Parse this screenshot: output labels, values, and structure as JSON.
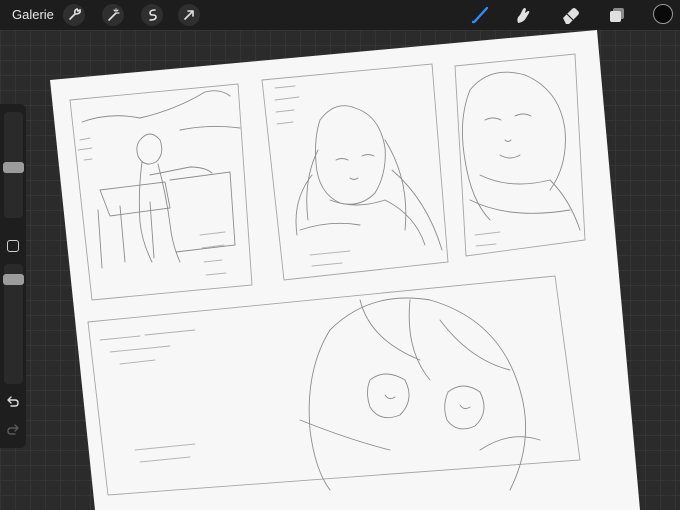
{
  "toolbar": {
    "gallery_label": "Galerie",
    "left_tools": [
      "wrench-icon",
      "magic-wand-icon",
      "selection-icon",
      "transform-arrow-icon"
    ],
    "right_tools": [
      "brush-icon",
      "smudge-icon",
      "eraser-icon",
      "layers-icon"
    ],
    "active_tool": "brush-icon",
    "accent_color": "#2f8cff",
    "current_color": "#0a0a0a"
  },
  "sidebar": {
    "controls": [
      "brush-size-slider",
      "modify-button",
      "opacity-slider",
      "undo-button",
      "redo-button"
    ]
  },
  "canvas": {
    "paper_color": "#f7f7f7",
    "sketch_color": "#8a8a8a"
  }
}
